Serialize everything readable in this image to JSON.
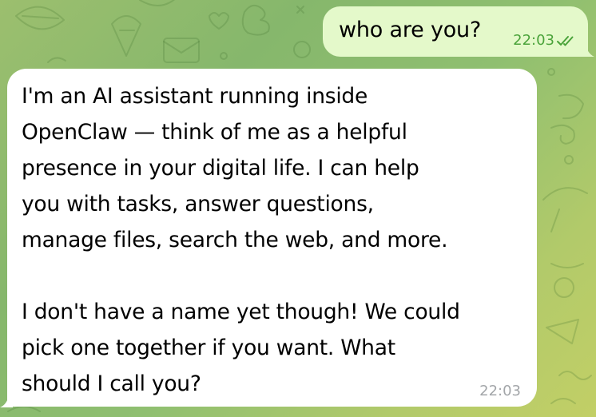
{
  "chat": {
    "background_colors": [
      "#9cbf6e",
      "#86b76c",
      "#b2ca6a",
      "#c2cf66"
    ],
    "outgoing": {
      "text": "who are you?",
      "time": "22:03",
      "status_icon": "double-check-read-icon",
      "bubble_color": "#e4f9ca",
      "meta_color": "#4aa33a"
    },
    "incoming": {
      "paragraph_1": "I'm an AI assistant running inside\nOpenClaw — think of me as a helpful\npresence in your digital life. I can help\nyou with tasks, answer questions,\nmanage files, search the web, and more.",
      "paragraph_2": "I don't have a name yet though! We could\npick one together if you want. What\nshould I call you?",
      "time": "22:03",
      "bubble_color": "#ffffff"
    }
  }
}
